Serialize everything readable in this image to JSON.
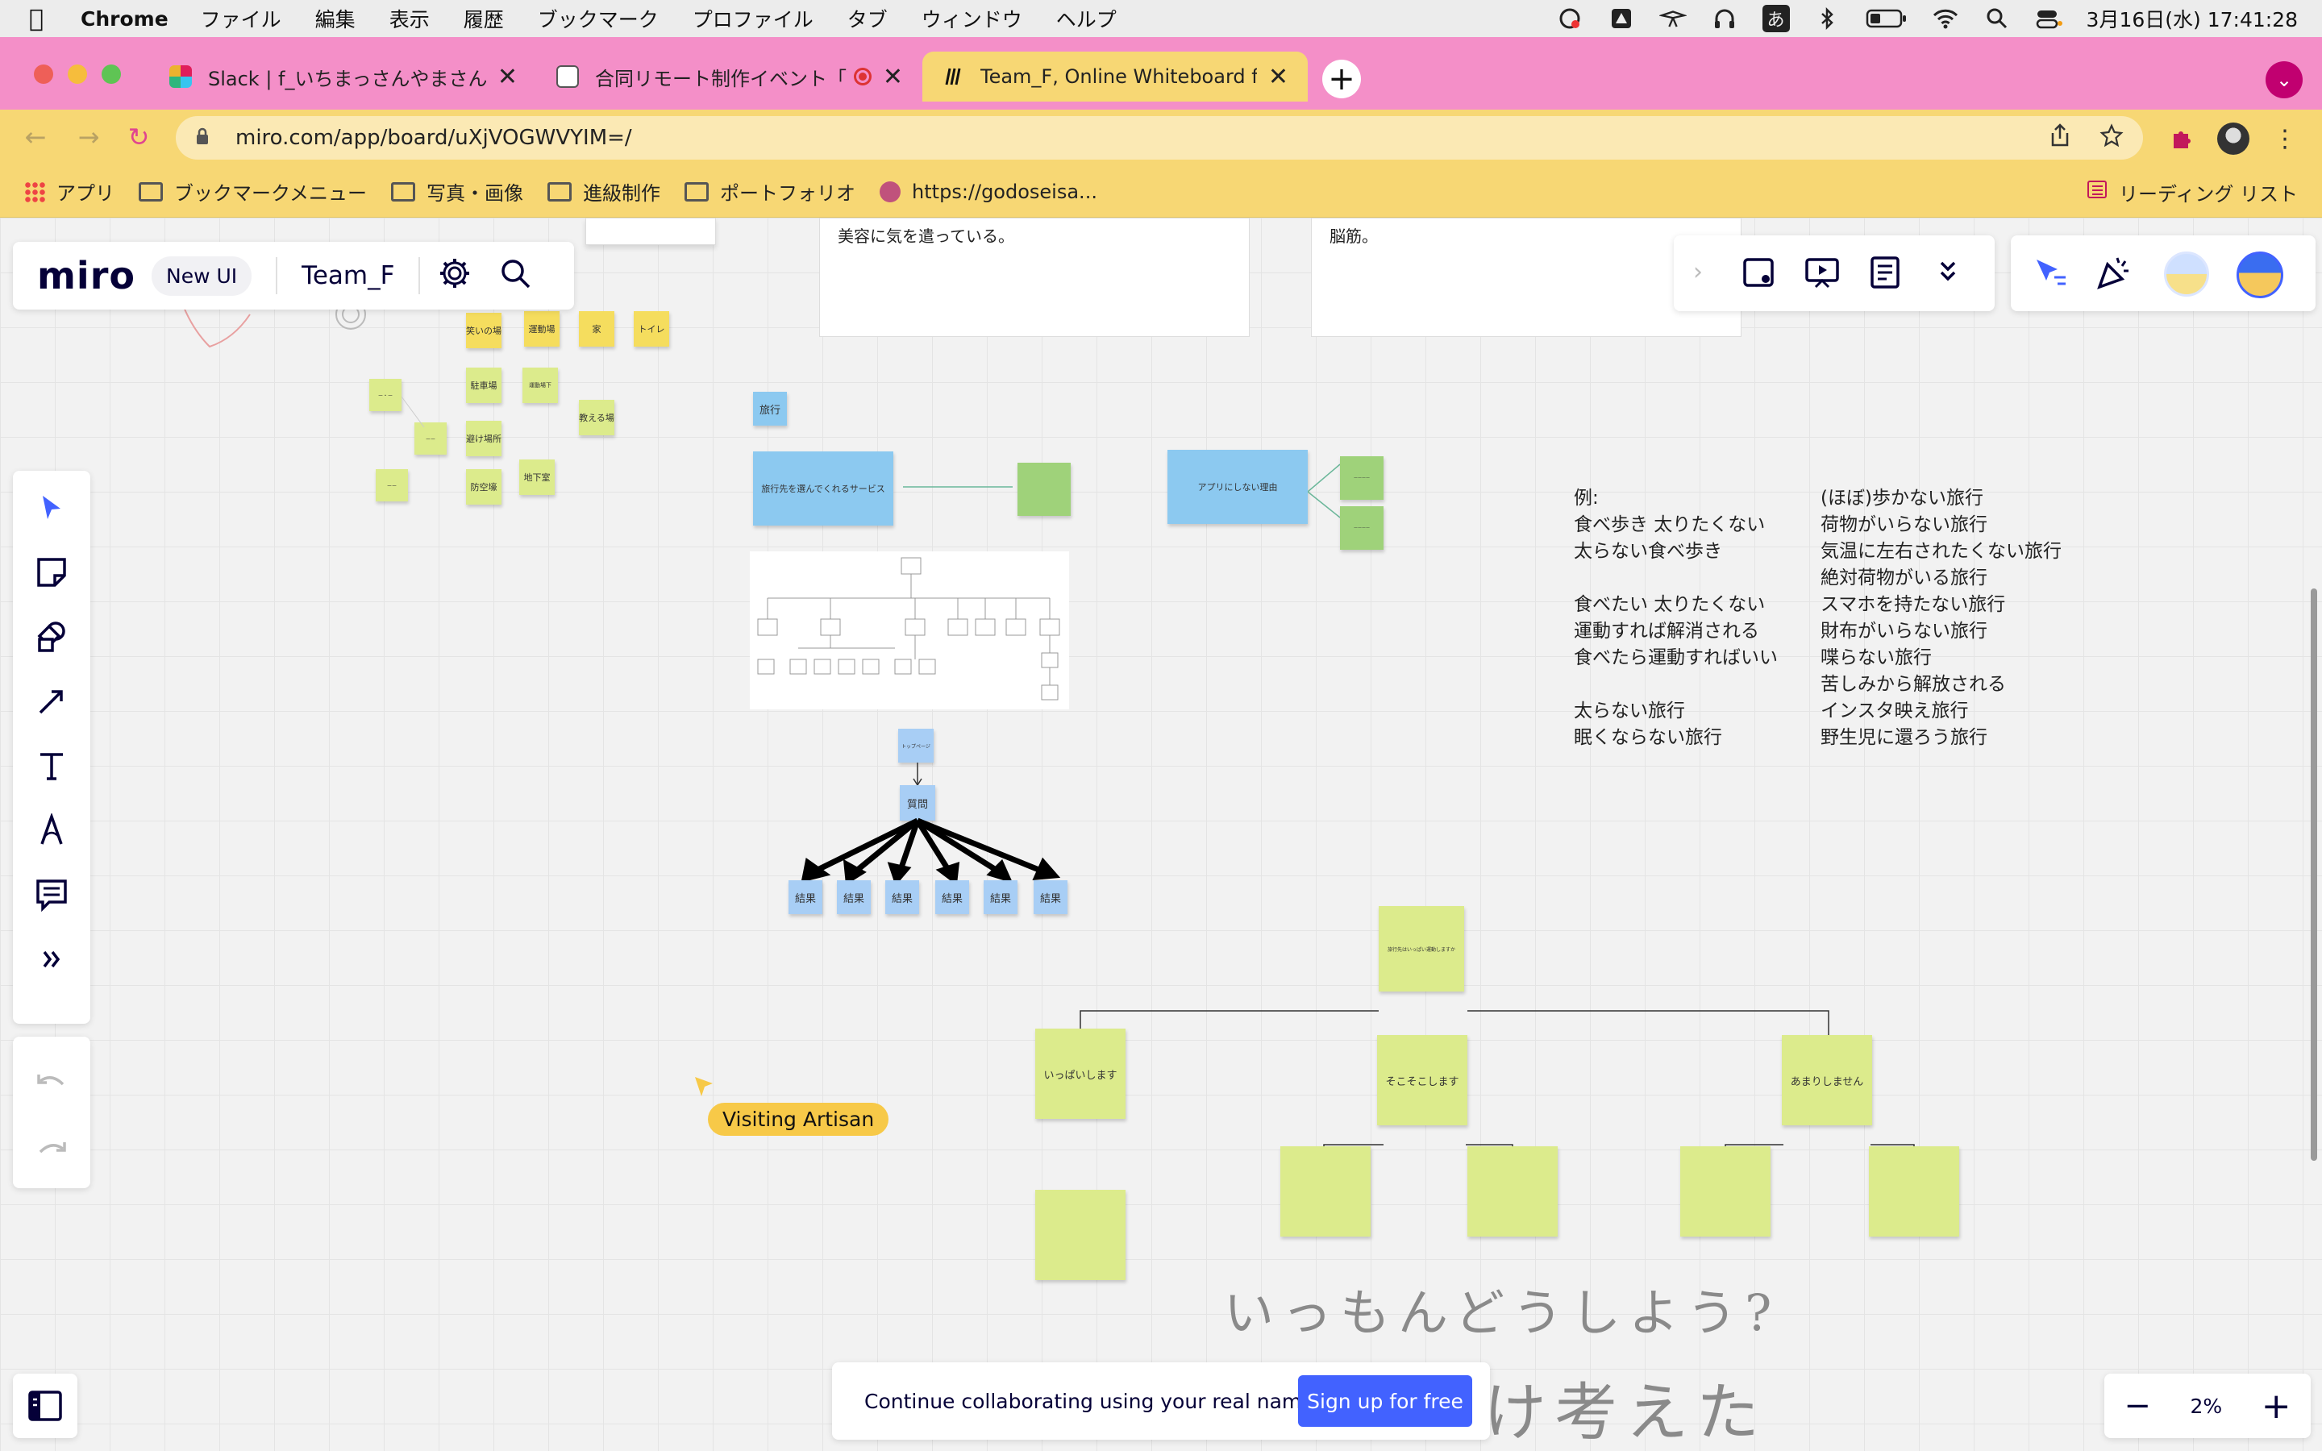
{
  "menubar": {
    "app": "Chrome",
    "items": [
      "ファイル",
      "編集",
      "表示",
      "履歴",
      "ブックマーク",
      "プロファイル",
      "タブ",
      "ウィンドウ",
      "ヘルプ"
    ],
    "ime": "あ",
    "clock": "3月16日(水)  17:41:28"
  },
  "tabs": [
    {
      "label": "Slack | f_いちまっさんやまさん |"
    },
    {
      "label": "合同リモート制作イベント「W"
    },
    {
      "label": "Team_F, Online Whiteboard for"
    }
  ],
  "address": {
    "url": "miro.com/app/board/uXjVOGWVYIM=/"
  },
  "bookmarks": {
    "items": [
      "アプリ",
      "ブックマークメニュー",
      "写真・画像",
      "進級制作",
      "ポートフォリオ",
      "https://godoseisa..."
    ],
    "reading_list": "リーディング リスト"
  },
  "miro": {
    "logo": "miro",
    "new_ui": "New UI",
    "board_name": "Team_F",
    "bottom_message": "Continue collaborating using your real name.",
    "signup": "Sign up for free",
    "zoom": "2%",
    "zoom_minus": "−",
    "zoom_plus": "+",
    "cursor_user": "Visiting Artisan"
  },
  "board": {
    "card1_text": "美容に気を遣っている。",
    "card2_text": "脳筋。",
    "top_stickies": [
      "笑いの場",
      "運動場",
      "家",
      "トイレ",
      "駐車場",
      "運動場下",
      "教える場",
      "避け場所",
      "防空壕",
      "地下室"
    ],
    "travel_label": "旅行",
    "service_label": "旅行先を選んでくれるサービス",
    "reason_label": "アプリにしない理由",
    "flow_top": "トップページ",
    "flow_question": "質問",
    "flow_results": [
      "結果",
      "結果",
      "結果",
      "結果",
      "結果",
      "結果"
    ],
    "tree_root": "旅行先はいっぱい運動しますか",
    "tree_left": "いっぱいします",
    "tree_mid": "そこそこします",
    "tree_right": "あまりしません",
    "examples_left": [
      "例:",
      "食べ歩き 太りたくない",
      "太らない食べ歩き",
      "",
      "食べたい 太りたくない",
      "運動すれば解消される",
      "食べたら運動すればいい",
      "",
      "太らない旅行",
      "眠くならない旅行"
    ],
    "examples_right": [
      "(ほぼ)歩かない旅行",
      "荷物がいらない旅行",
      "気温に左右されたくない旅行",
      "絶対荷物がいる旅行",
      "スマホを持たない旅行",
      "財布がいらない旅行",
      "喋らない旅行",
      "苦しみから解放される",
      "インスタ映え旅行",
      "野生児に還ろう旅行"
    ],
    "handwriting_1": "いっもんどうしよう?",
    "handwriting_2": "け考えた"
  }
}
